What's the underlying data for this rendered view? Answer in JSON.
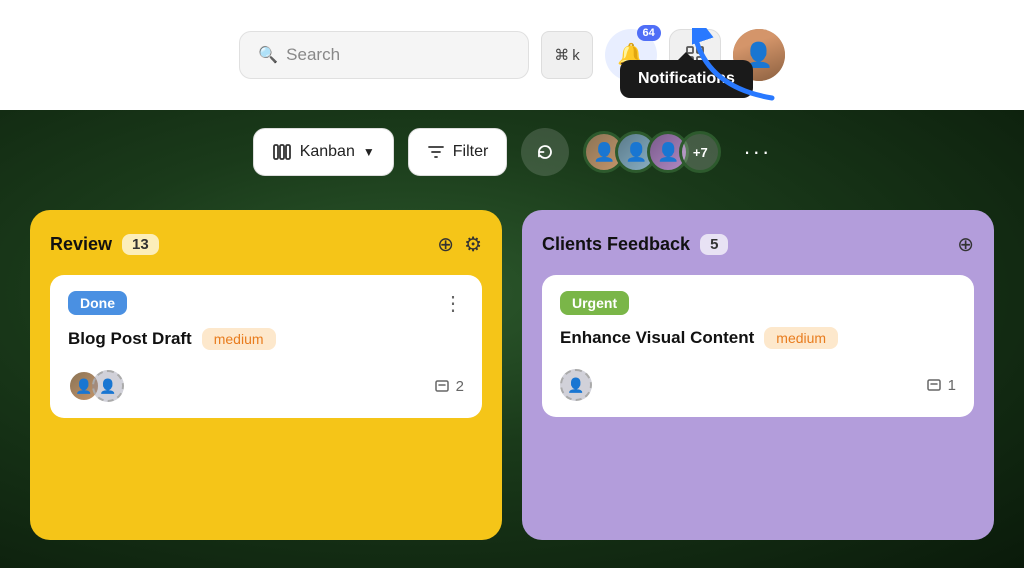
{
  "header": {
    "search_placeholder": "Search",
    "kbd_cmd": "⌘",
    "kbd_key": "k",
    "notif_count": "64",
    "tooltip_text": "Notifications"
  },
  "toolbar": {
    "kanban_label": "Kanban",
    "filter_label": "Filter",
    "plus_more_label": "+7"
  },
  "boards": [
    {
      "title": "Review",
      "count": "13",
      "card": {
        "tag": "Done",
        "tag_type": "done",
        "task_title": "Blog Post Draft",
        "priority": "medium",
        "subtask_count": "2"
      }
    },
    {
      "title": "Clients Feedback",
      "count": "5",
      "card": {
        "tag": "Urgent",
        "tag_type": "urgent",
        "task_title": "Enhance Visual Content",
        "priority": "medium",
        "subtask_count": "1"
      }
    }
  ]
}
